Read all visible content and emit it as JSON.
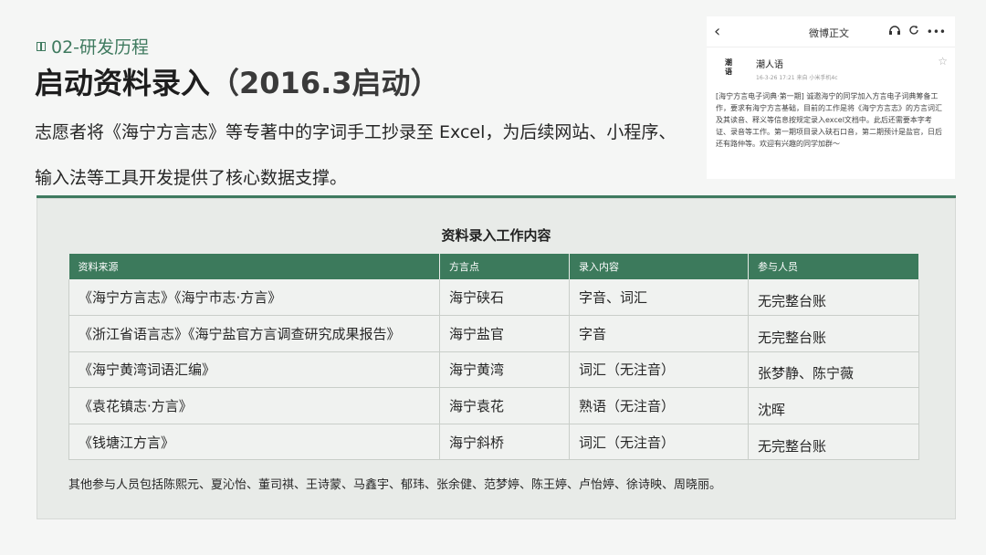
{
  "section": {
    "label": "02-研发历程"
  },
  "title": {
    "main": "启动资料录入",
    "sub": "（2016.3启动）"
  },
  "intro": "志愿者将《海宁方言志》等专著中的字词手工抄录至 Excel，为后续网站、小程序、输入法等工具开发提供了核心数据支撑。",
  "weibo": {
    "back_icon": "chevron-left-icon",
    "nav_title": "微博正文",
    "user_name": "潮人语",
    "avatar_text": [
      "潮",
      "语"
    ],
    "meta": "16-3-26 17:21  来自 小米手机4c",
    "content": "[海宁方言电子词典·第一期] 诚邀海宁的同学加入方言电子词典筹备工作，要求有海宁方言基础，目前的工作是将《海宁方言志》的方言词汇及其读音、释义等信息按规定录入excel文档中。此后还需要本字考证、录音等工作。第一期项目录入硖石口音，第二期预计是盐官，日后还有路仲等。欢迎有兴趣的同学加群～"
  },
  "table": {
    "title": "资料录入工作内容",
    "headers": [
      "资料来源",
      "方言点",
      "录入内容",
      "参与人员"
    ],
    "rows": [
      [
        "《海宁方言志》《海宁市志·方言》",
        "海宁硖石",
        "字音、词汇",
        "无完整台账"
      ],
      [
        "《浙江省语言志》《海宁盐官方言调查研究成果报告》",
        "海宁盐官",
        "字音",
        "无完整台账"
      ],
      [
        "《海宁黄湾词语汇编》",
        "海宁黄湾",
        "词汇（无注音）",
        "张梦静、陈宁薇"
      ],
      [
        "《袁花镇志·方言》",
        "海宁袁花",
        "熟语（无注音）",
        "沈晖"
      ],
      [
        "《钱塘江方言》",
        "海宁斜桥",
        "词汇（无注音）",
        "无完整台账"
      ]
    ],
    "footnote": "其他参与人员包括陈熙元、夏沁怡、董司祺、王诗蒙、马鑫宇、郁玮、张余健、范梦婷、陈王婷、卢怡婷、徐诗映、周晓丽。"
  },
  "colors": {
    "accent": "#3f7a5f",
    "header_bg": "#3c7a5c",
    "panel_bg": "#e8ebe8"
  }
}
